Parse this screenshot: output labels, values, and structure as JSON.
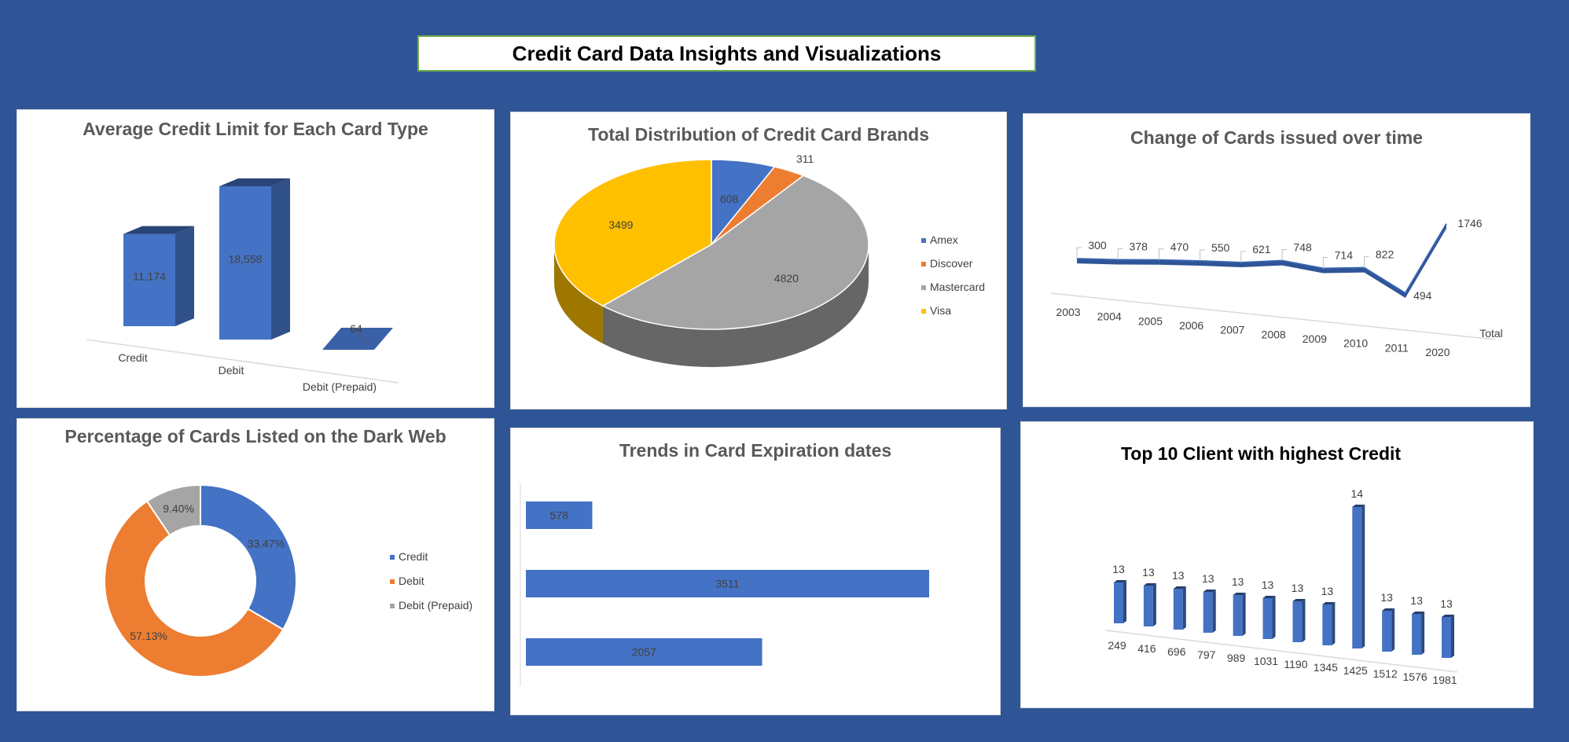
{
  "page": {
    "title": "Credit Card Data Insights and Visualizations"
  },
  "chart_data": [
    {
      "id": "avg_limit",
      "type": "bar",
      "title": "Average Credit Limit for Each Card Type",
      "categories": [
        "Credit",
        "Debit",
        "Debit (Prepaid)"
      ],
      "values": [
        11174,
        18558,
        64
      ],
      "value_labels": [
        "11,174",
        "18,558",
        "64"
      ],
      "color": "#4472C4"
    },
    {
      "id": "brand_distribution",
      "type": "pie",
      "title": "Total Distribution of Credit Card Brands",
      "categories": [
        "Amex",
        "Discover",
        "Mastercard",
        "Visa"
      ],
      "values": [
        608,
        311,
        4820,
        3499
      ],
      "colors": [
        "#4472C4",
        "#ED7D31",
        "#A5A5A5",
        "#FFC000"
      ],
      "legend": "right"
    },
    {
      "id": "cards_over_time",
      "type": "line",
      "title": "Change of Cards issued over time",
      "categories": [
        "2003",
        "2004",
        "2005",
        "2006",
        "2007",
        "2008",
        "2009",
        "2010",
        "2011",
        "2020"
      ],
      "series": [
        {
          "name": "Total",
          "values": [
            300,
            378,
            470,
            550,
            621,
            748,
            714,
            822,
            494,
            1746
          ]
        }
      ],
      "color": "#2F5597"
    },
    {
      "id": "dark_web",
      "type": "pie",
      "title": "Percentage of Cards Listed on the Dark Web",
      "categories": [
        "Credit",
        "Debit",
        "Debit (Prepaid)"
      ],
      "values": [
        33.47,
        57.13,
        9.4
      ],
      "value_labels": [
        "33.47%",
        "57.13%",
        "9.40%"
      ],
      "colors": [
        "#4472C4",
        "#ED7D31",
        "#A5A5A5"
      ],
      "legend": "right"
    },
    {
      "id": "expiration_trends",
      "type": "bar",
      "title": "Trends in Card Expiration dates",
      "orientation": "horizontal",
      "values": [
        578,
        3511,
        2057
      ],
      "color": "#4472C4"
    },
    {
      "id": "top_clients",
      "type": "bar",
      "title": "Top 10 Client with highest Credit",
      "categories": [
        "249",
        "416",
        "696",
        "797",
        "989",
        "1031",
        "1190",
        "1345",
        "1425",
        "1512",
        "1576",
        "1981"
      ],
      "values": [
        13,
        13,
        13,
        13,
        13,
        13,
        13,
        13,
        14,
        13,
        13,
        13
      ],
      "color": "#4472C4"
    }
  ]
}
